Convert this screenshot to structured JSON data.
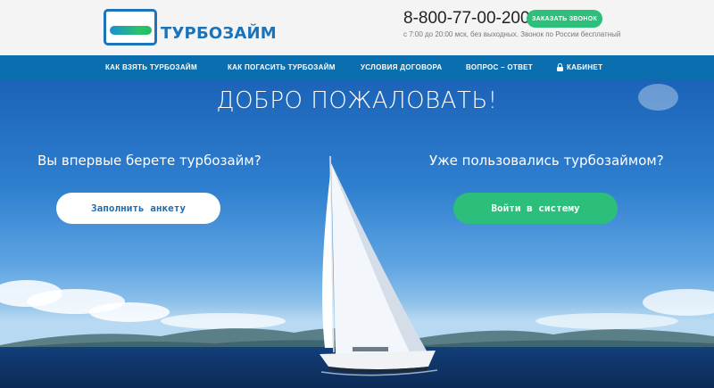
{
  "header": {
    "logo_text": "ТУРБОЗАЙМ",
    "phone": "8-800-77-00-200",
    "phone_note": "с 7:00 до 20:00 мск, без выходных. Звонок по России бесплатный",
    "callback_label": "ЗАКАЗАТЬ ЗВОНОК"
  },
  "nav": {
    "items": [
      {
        "label": "КАК ВЗЯТЬ ТУРБОЗАЙМ"
      },
      {
        "label": "КАК ПОГАСИТЬ ТУРБОЗАЙМ"
      },
      {
        "label": "УСЛОВИЯ ДОГОВОРА"
      },
      {
        "label": "ВОПРОС – ОТВЕТ"
      },
      {
        "label": "КАБИНЕТ"
      }
    ]
  },
  "hero": {
    "title": "ДОБРО ПОЖАЛОВАТЬ!",
    "new_question": "Вы впервые берете турбозайм?",
    "new_button": "Заполнить анкету",
    "returning_question": "Уже пользовались турбозаймом?",
    "returning_button": "Войти в систему"
  },
  "colors": {
    "brand_blue": "#1b73b9",
    "nav_blue": "#0b6eae",
    "accent_green": "#2ec07a"
  },
  "icons": {
    "cabinet": "lock-icon",
    "logo": "turbozaim-logo-icon"
  }
}
